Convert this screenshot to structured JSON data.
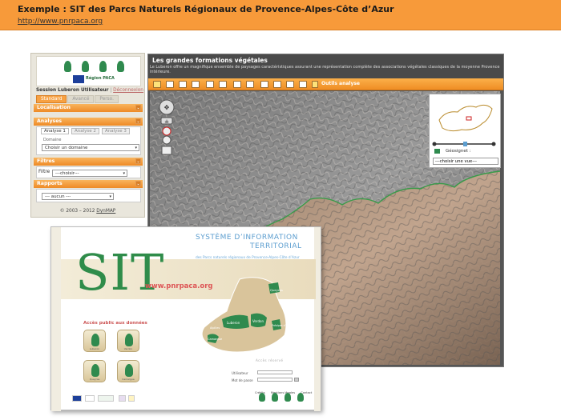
{
  "header": {
    "title": "Exemple : SIT des Parcs Naturels Régionaux de Provence-Alpes-Côte d’Azur",
    "url": "http://www.pnrpaca.org"
  },
  "left_panel": {
    "logo_text": "Région PACA",
    "session_label": "Session Luberon Utilisateur",
    "session_sep": " | ",
    "logout": "Déconnexion",
    "tabs": [
      {
        "label": "Standard",
        "active": true
      },
      {
        "label": "Avancé",
        "active": false
      },
      {
        "label": "Perso.",
        "active": false
      }
    ],
    "sections": {
      "localisation": "Localisation",
      "analyses": "Analyses",
      "filtres": "Filtres",
      "rapports": "Rapports"
    },
    "analyse_tabs": [
      "Analyse 1",
      "Analyse 2",
      "Analyse 3"
    ],
    "domain_label": "Domaine",
    "domain_select": "Choisir un domaine",
    "filter_label": "Filtre",
    "filter_select": "---choisir---",
    "report_select": "--- aucun ---",
    "copyright": "© 2003 – 2012",
    "copyright_link": "DynMAP"
  },
  "map_app": {
    "title": "Les grandes formations végétales",
    "description": "Le Luberon offre un magnifique ensemble de paysages caractéristiques assurant une représentation complète des associations végétales classiques de la moyenne Provence intérieure.",
    "quick_analysis": "Outils analyse",
    "minimap": {
      "geo_label": "Géosignet :",
      "view_select": "---choisir une vue---"
    },
    "colors": {
      "accent": "#f79a3a",
      "contour": "#3a9a4a"
    }
  },
  "sit_portal": {
    "big_title": "SIT",
    "site": "www.pnrpaca.org",
    "title_line1": "SYSTÈME D’INFORMATION",
    "title_line2": "TERRITORIAL",
    "subtitle": "des Parcs naturels régionaux de Provence-Alpes-Côte d’Azur",
    "public_access": "Accès public aux données",
    "parks": [
      "Luberon",
      "Verdon",
      "Queyras",
      "Camargue"
    ],
    "map_labels": {
      "queyras": "Queyras",
      "luberon": "Luberon",
      "verdon": "Verdon",
      "camargue": "Camargue",
      "alpilles": "Alpilles",
      "prealpes": "Préalpes d’Azur"
    },
    "login": {
      "heading": "Accès réservé",
      "user_label": "Utilisateur",
      "password_label": "Mot de passe"
    },
    "footer_links": [
      "Crédits",
      "Mentions légales",
      "Contact"
    ]
  }
}
